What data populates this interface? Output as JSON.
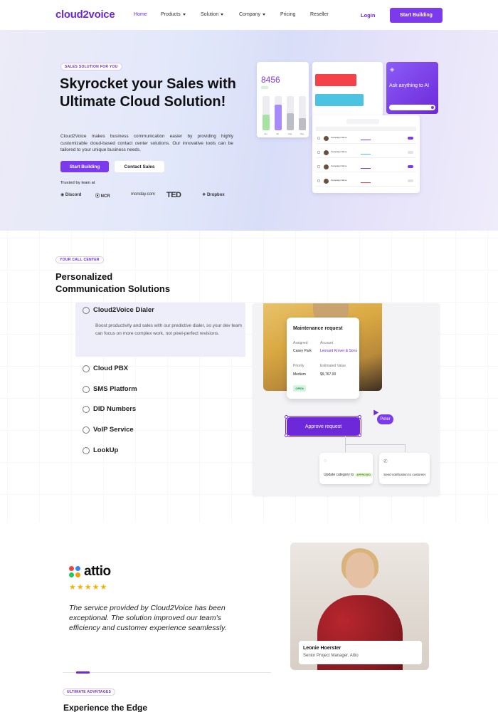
{
  "nav": {
    "logo": "cloud2voice",
    "items": [
      {
        "label": "Home",
        "dropdown": false
      },
      {
        "label": "Products",
        "dropdown": true
      },
      {
        "label": "Solution",
        "dropdown": true
      },
      {
        "label": "Company",
        "dropdown": true
      },
      {
        "label": "Pricing",
        "dropdown": false
      },
      {
        "label": "Reseller",
        "dropdown": false
      }
    ],
    "login": "Login",
    "cta": "Start Building"
  },
  "hero": {
    "badge": "SALES SOLUTION FOR YOU",
    "title": "Skyrocket your Sales with Ultimate Cloud Solution!",
    "description": "Cloud2Voice makes business communication easier by providing highly customizable cloud-based contact center solutions. Our innovative tools can be tailored to your unique business needs.",
    "primary_button": "Start Building",
    "secondary_button": "Contact Sales",
    "trusted_label": "Trusted by team at",
    "brands": [
      "Discord",
      "NCR",
      "monday.com",
      "TED",
      "Dropbox"
    ]
  },
  "dashboard": {
    "stat_value": "8456",
    "bars": [
      {
        "label": "Jun",
        "level": 0.45,
        "color": "#a7e3a0"
      },
      {
        "label": "Jul",
        "level": 0.75,
        "color": "#a78bfa"
      },
      {
        "label": "Aug",
        "level": 0.5,
        "color": "#bdbdc6"
      },
      {
        "label": "Sep",
        "level": 0.35,
        "color": "#bdbdc6"
      }
    ],
    "ask_text": "Ask anything to AI",
    "rows": [
      {
        "name": "Campaign Name",
        "toggle_on": true
      },
      {
        "name": "Campaign Name",
        "toggle_on": false
      },
      {
        "name": "Campaign Name",
        "toggle_on": true
      },
      {
        "name": "Campaign Name",
        "toggle_on": false
      }
    ]
  },
  "call_center": {
    "badge": "YOUR CALL CENTER",
    "title_line1": "Personalized",
    "title_line2": "Communication Solutions",
    "features": [
      {
        "label": "Cloud2Voice Dialer",
        "icon": "dialer-icon"
      },
      {
        "label": "Cloud PBX",
        "icon": "cloud-icon"
      },
      {
        "label": "SMS Platform",
        "icon": "sms-icon"
      },
      {
        "label": "DID Numbers",
        "icon": "phone-icon"
      },
      {
        "label": "VoIP Service",
        "icon": "headset-icon"
      },
      {
        "label": "LookUp",
        "icon": "lookup-icon"
      }
    ],
    "active_description": "Boost productivity and sales with our predictive dialer, so your dev team can focus on more complex work, not pixel-perfect revisions.",
    "maintenance": {
      "title": "Maintenance request",
      "assigned_label": "Assigned",
      "assigned_value": "Casey Park",
      "account_label": "Account",
      "account_value": "Leonard Krover & Sons",
      "priority_label": "Priority",
      "priority_value": "Medium",
      "estimated_label": "Estimated Value",
      "estimated_value": "$9,767.00",
      "status": "OPEN"
    },
    "approve_button": "Approve request",
    "cursor_name": "Peter",
    "node_left_text": "Update category to",
    "node_left_chip": "APPROVED",
    "node_right_text": "Send notification to customer"
  },
  "testimonial": {
    "company": "attio",
    "stars": "★★★★★",
    "quote": "The service provided by Cloud2Voice has been exceptional. The solution improved our team's efficiency and customer experience seamlessly.",
    "person_name": "Leonie Hoerster",
    "person_role": "Senior Project Manager, Attio"
  },
  "advantages": {
    "badge": "ULTIMATE ADVNTAGES",
    "title": "Experience the Edge"
  },
  "colors": {
    "accent": "#7c3aed",
    "accent_dark": "#6d28d9",
    "star": "#f5b400"
  }
}
